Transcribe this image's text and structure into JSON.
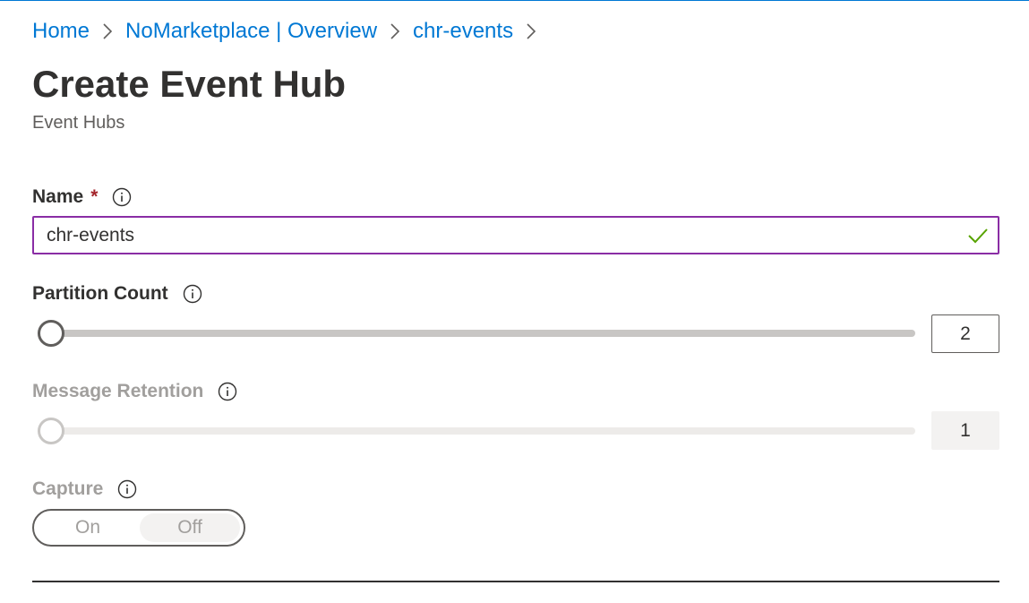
{
  "breadcrumb": {
    "items": [
      "Home",
      "NoMarketplace | Overview",
      "chr-events"
    ]
  },
  "header": {
    "title": "Create Event Hub",
    "subtitle": "Event Hubs"
  },
  "form": {
    "name": {
      "label": "Name",
      "required_marker": "*",
      "value": "chr-events",
      "valid": true
    },
    "partition_count": {
      "label": "Partition Count",
      "value": "2"
    },
    "message_retention": {
      "label": "Message Retention",
      "value": "1",
      "disabled": true
    },
    "capture": {
      "label": "Capture",
      "options": [
        "On",
        "Off"
      ],
      "selected": "Off",
      "disabled": true
    }
  },
  "colors": {
    "link": "#0078d4",
    "input_focus_border": "#8a2da5",
    "valid_check": "#57a300",
    "required": "#a4262c"
  },
  "icons": {
    "breadcrumb_separator": "chevron-right-icon",
    "info": "info-icon",
    "valid": "checkmark-icon"
  }
}
